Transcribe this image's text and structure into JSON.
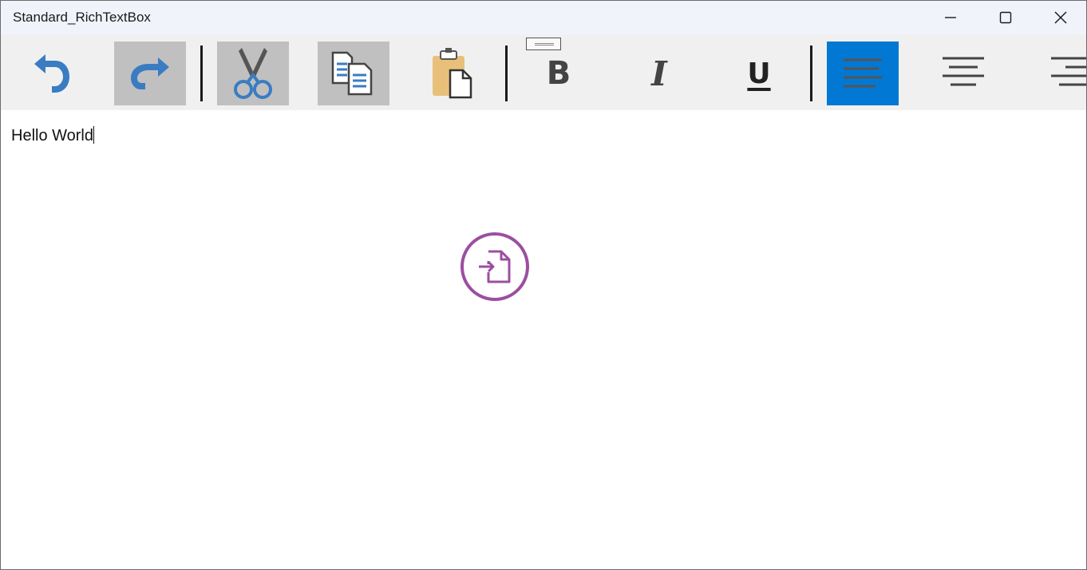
{
  "window": {
    "title": "Standard_RichTextBox",
    "controls": [
      "minimize-icon",
      "maximize-icon",
      "close-icon"
    ]
  },
  "toolbar": {
    "buttons": [
      {
        "name": "undo",
        "icon": "undo-icon",
        "state": "normal"
      },
      {
        "name": "redo",
        "icon": "redo-icon",
        "state": "pressed"
      },
      {
        "name": "cut",
        "icon": "scissors-icon",
        "state": "pressed"
      },
      {
        "name": "copy",
        "icon": "copy-icon",
        "state": "pressed"
      },
      {
        "name": "paste",
        "icon": "paste-icon",
        "state": "normal"
      },
      {
        "name": "bold",
        "icon": "bold-icon",
        "state": "normal",
        "label": "B"
      },
      {
        "name": "italic",
        "icon": "italic-icon",
        "state": "normal",
        "label": "I"
      },
      {
        "name": "underline",
        "icon": "underline-icon",
        "state": "normal",
        "label": "U"
      },
      {
        "name": "align-left",
        "icon": "align-left-icon",
        "state": "checked"
      },
      {
        "name": "align-center",
        "icon": "align-center-icon",
        "state": "normal"
      },
      {
        "name": "align-right",
        "icon": "align-right-icon",
        "state": "normal"
      }
    ]
  },
  "editor": {
    "text": "Hello World",
    "drop_indicator_icon": "file-import-icon"
  },
  "colors": {
    "titlebar": "#f0f4fa",
    "toolbar": "#f0f0f0",
    "pressed": "#c0c0c0",
    "checked": "#0078d4",
    "icon_blue": "#3a7cc2",
    "drop_icon": "#9b4fa0"
  }
}
